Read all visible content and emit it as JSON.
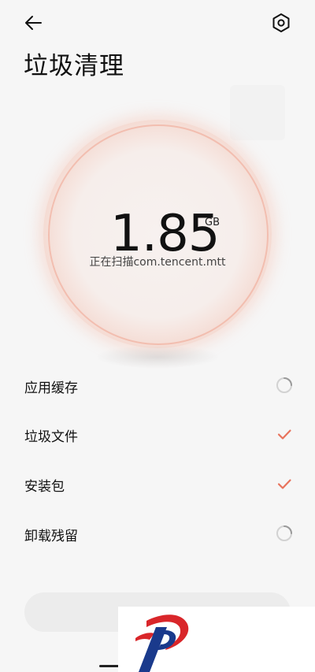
{
  "header": {
    "back_icon": "arrow-left-icon",
    "settings_icon": "hexagon-gear-icon"
  },
  "page": {
    "title": "垃圾清理"
  },
  "scan": {
    "size_value": "1.85",
    "size_unit": "GB",
    "status_text": "正在扫描com.tencent.mtt"
  },
  "categories": [
    {
      "label": "应用缓存",
      "status": "scanning",
      "status_icon": "spinner-icon"
    },
    {
      "label": "垃圾文件",
      "status": "done",
      "status_icon": "checkmark-icon"
    },
    {
      "label": "安装包",
      "status": "done",
      "status_icon": "checkmark-icon"
    },
    {
      "label": "卸载残留",
      "status": "scanning",
      "status_icon": "spinner-icon"
    }
  ],
  "colors": {
    "accent_check": "#e8735c",
    "orb_edge": "#ef9f8b",
    "background": "#f6f6f6"
  }
}
